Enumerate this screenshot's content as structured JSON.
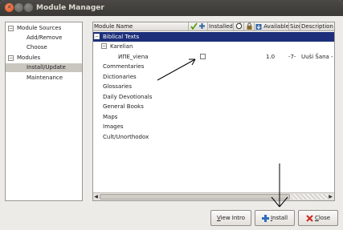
{
  "window": {
    "title": "Module Manager"
  },
  "left_tree": {
    "sections": [
      {
        "label": "Module Sources",
        "expanded": true,
        "children": [
          "Add/Remove",
          "Choose"
        ]
      },
      {
        "label": "Modules",
        "expanded": true,
        "children": [
          "Install/Update",
          "Maintenance"
        ]
      }
    ],
    "selected": "Install/Update"
  },
  "table": {
    "columns": {
      "name": "Module Name",
      "installed": "Installed",
      "available": "Available",
      "size": "Size",
      "description": "Description"
    },
    "group": "Biblical Texts",
    "subgroup": "Karelian",
    "module": {
      "name": "ИПЕ_viena",
      "available": "1.0",
      "size": "-7-",
      "description": "Uuši Šana -"
    },
    "categories": [
      "Commentaries",
      "Dictionaries",
      "Glossaries",
      "Daily Devotionals",
      "General Books",
      "Maps",
      "Images",
      "Cult/Unorthodox"
    ]
  },
  "buttons": {
    "view_intro": {
      "mnemonic": "V",
      "rest": "iew Intro"
    },
    "install": {
      "mnemonic": "I",
      "rest": "nstall"
    },
    "close": {
      "mnemonic": "C",
      "rest": "lose"
    }
  },
  "colors": {
    "selection": "#1d2f7a",
    "close_icon": "#d0281e",
    "install_icon": "#2f6fbf"
  }
}
